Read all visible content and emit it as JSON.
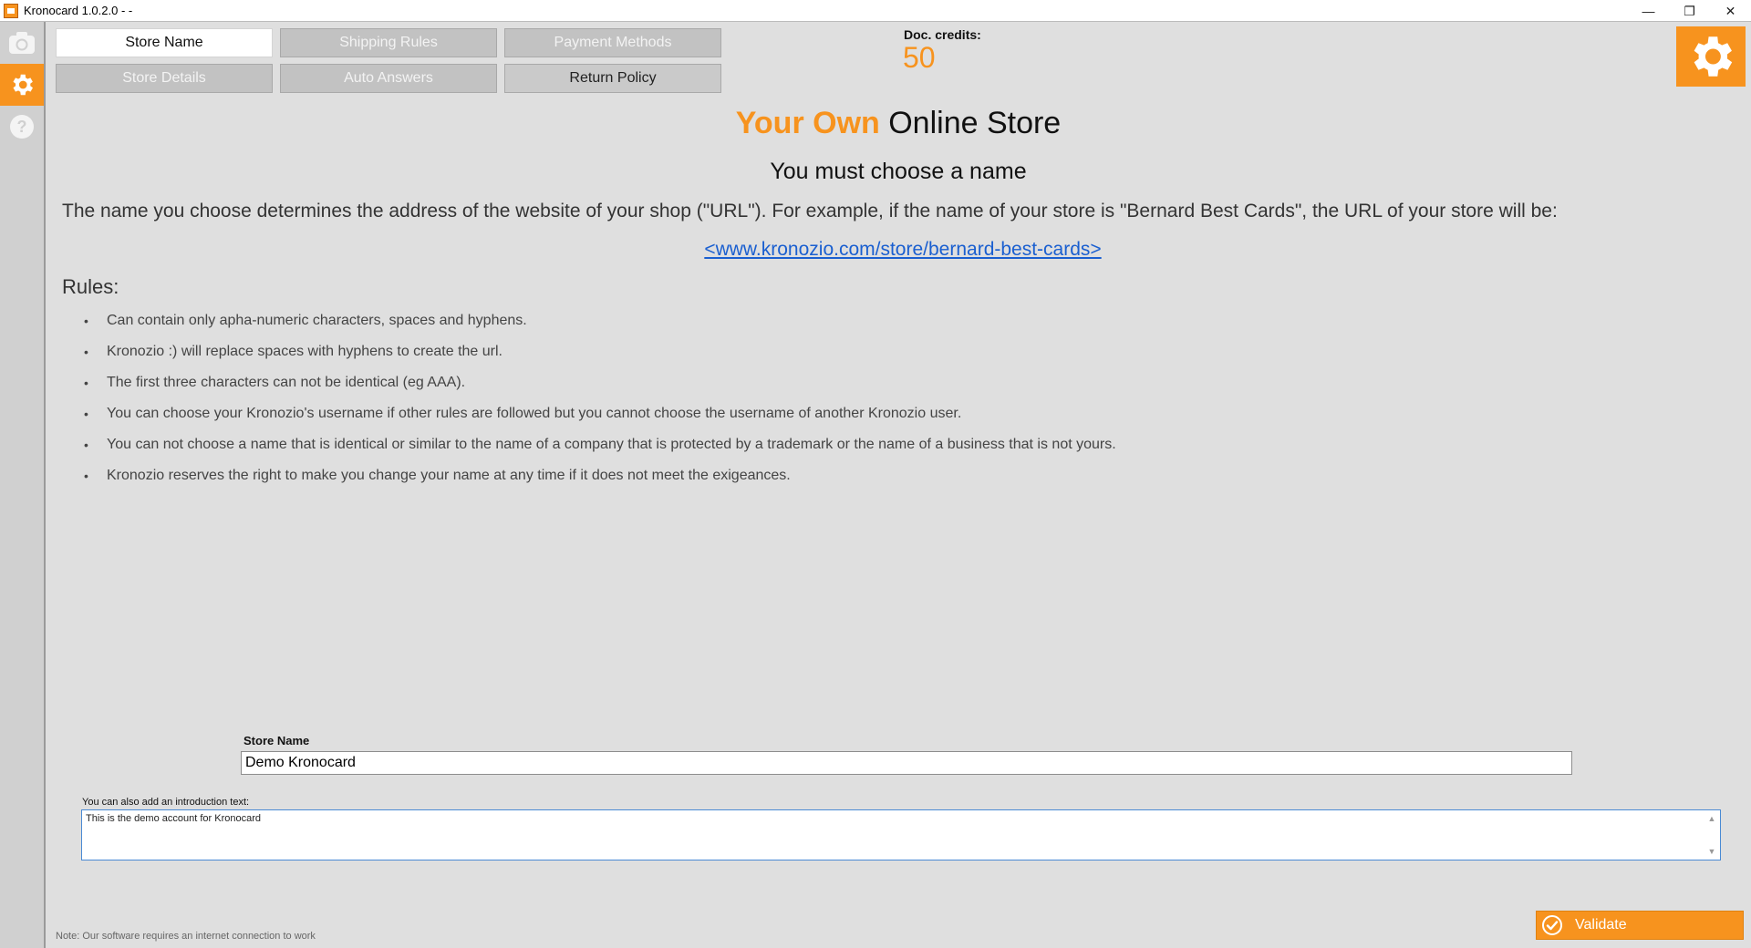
{
  "window": {
    "title": "Kronocard 1.0.2.0 -  -",
    "minimize_glyph": "—",
    "restore_glyph": "❐",
    "close_glyph": "✕"
  },
  "sidebar": {
    "items": [
      {
        "icon": "camera-icon",
        "active": false
      },
      {
        "icon": "gear-icon",
        "active": true
      },
      {
        "icon": "help-icon",
        "active": false
      }
    ]
  },
  "tabs": [
    {
      "label": "Store Name",
      "active": true
    },
    {
      "label": "Shipping Rules",
      "active": false
    },
    {
      "label": "Payment Methods",
      "active": false
    },
    {
      "label": "Store Details",
      "active": false
    },
    {
      "label": "Auto Answers",
      "active": false
    },
    {
      "label": "Return Policy",
      "active": false
    }
  ],
  "credits": {
    "label": "Doc. credits:",
    "value": "50"
  },
  "content": {
    "headline_accent": "Your Own",
    "headline_rest": " Online Store",
    "subheadline": "You must choose a name",
    "description": "The name you choose determines the address of the website of your shop (\"URL\"). For example, if the name of your store is \"Bernard Best Cards\", the URL of your store will be:",
    "url": "<www.kronozio.com/store/bernard-best-cards>",
    "rules_title": "Rules:",
    "rules": [
      "Can contain only apha-numeric characters, spaces and hyphens.",
      "Kronozio :) will replace spaces with hyphens to create the url.",
      "The first three characters can not be identical (eg AAA).",
      "You can choose your Kronozio's username if other rules are followed but you cannot choose the username of another Kronozio user.",
      "You can not choose a name that is identical or similar to the name of a company that is protected by a trademark or the name of a business that is not yours.",
      "Kronozio reserves the right to make you change your name at any time if it does not meet the exigeances."
    ]
  },
  "form": {
    "store_name_label": "Store Name",
    "store_name_value": "Demo Kronocard",
    "intro_label": "You can also add an introduction text:",
    "intro_value": "This is the demo account for Kronocard"
  },
  "footer": {
    "note": "Note: Our software requires an internet connection to work",
    "validate_label": "Validate"
  },
  "colors": {
    "accent": "#f7931e",
    "link": "#1a5fd0",
    "background": "#dfdfdf"
  }
}
